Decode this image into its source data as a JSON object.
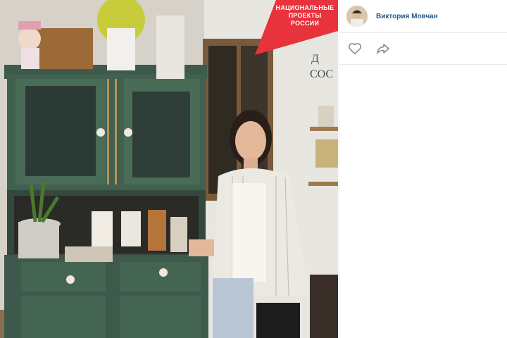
{
  "photo": {
    "badge": {
      "line1": "НАЦИОНАЛЬНЫЕ",
      "line2": "ПРОЕКТЫ",
      "line3": "РОССИИ"
    },
    "wall_sign": "Д\nСОС"
  },
  "post": {
    "author_name": "Виктория Мовчан"
  },
  "actions": {
    "like_icon": "heart-icon",
    "share_icon": "share-arrow-icon"
  },
  "colors": {
    "brand_link": "#2a5885",
    "badge_red": "#e8323c",
    "cabinet_green": "#3e5a4c",
    "icon_gray": "#818c99"
  }
}
